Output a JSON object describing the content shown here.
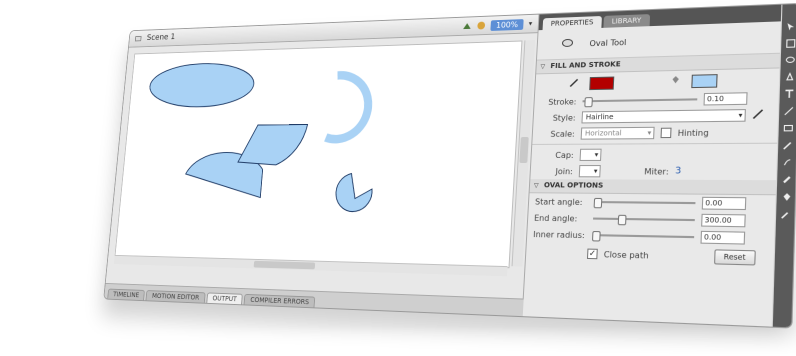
{
  "document": {
    "scene_label": "Scene 1",
    "zoom": "100%",
    "tabs": [
      "TIMELINE",
      "MOTION EDITOR",
      "OUTPUT",
      "COMPILER ERRORS"
    ]
  },
  "properties": {
    "tabs": [
      "PROPERTIES",
      "LIBRARY"
    ],
    "tool_name": "Oval Tool",
    "fill_stroke": {
      "header": "FILL AND STROKE",
      "stroke_color": "#b30000",
      "fill_color": "#a9d2f5",
      "stroke_label": "Stroke:",
      "stroke_value": "0.10",
      "style_label": "Style:",
      "style_value": "Hairline",
      "scale_label": "Scale:",
      "scale_value": "Horizontal",
      "hinting_label": "Hinting",
      "cap_label": "Cap:",
      "join_label": "Join:",
      "miter_label": "Miter:",
      "miter_value": "3"
    },
    "oval_options": {
      "header": "OVAL OPTIONS",
      "start_angle_label": "Start angle:",
      "start_angle_value": "0.00",
      "end_angle_label": "End angle:",
      "end_angle_value": "300.00",
      "inner_radius_label": "Inner radius:",
      "inner_radius_value": "0.00",
      "close_path_label": "Close path",
      "close_path_checked": true,
      "reset_label": "Reset"
    }
  },
  "colors": {
    "shape_fill": "#a9d2f5",
    "shape_stroke": "#1f3b66",
    "ring": "#a9d2f5"
  },
  "icons": [
    "scene-icon",
    "edit-scene-icon",
    "edit-symbol-icon",
    "oval-tool-icon",
    "pencil-icon",
    "paint-bucket-icon",
    "text-tool-icon",
    "transform-tool-icon",
    "line-tool-icon"
  ]
}
